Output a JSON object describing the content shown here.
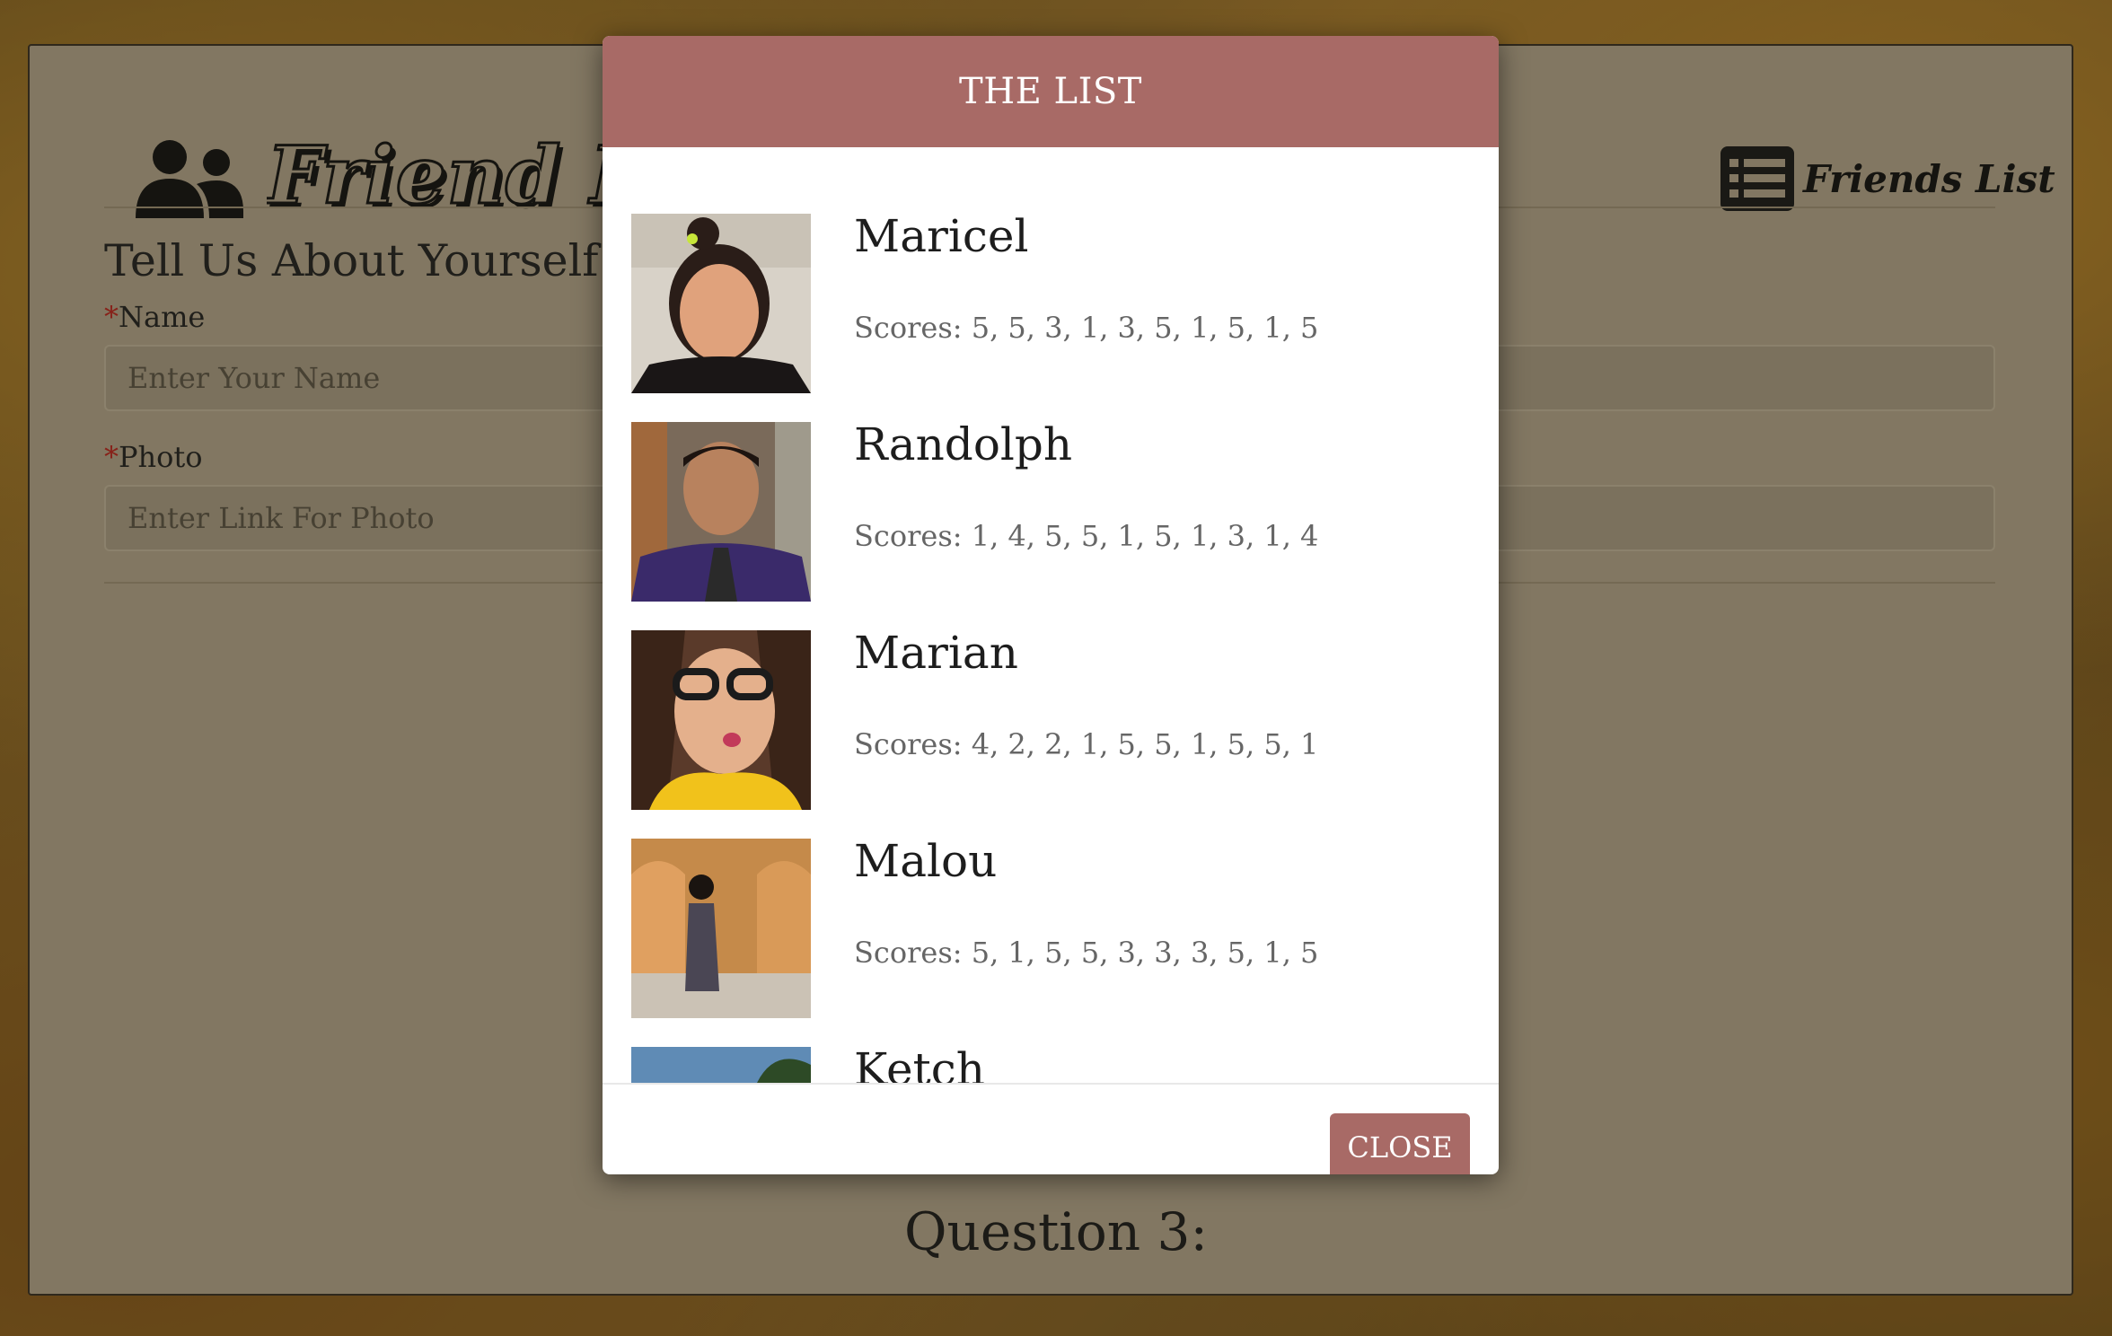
{
  "brand": {
    "title": "Friend Finder",
    "icon": "users-icon"
  },
  "nav": {
    "friends_list_label": "Friends List",
    "icon": "list-icon"
  },
  "form": {
    "section_title": "Tell Us About Yourself!",
    "required_mark": "*",
    "name_label": "Name",
    "name_placeholder": "Enter Your Name",
    "photo_label": "Photo",
    "photo_placeholder": "Enter Link For Photo"
  },
  "question": {
    "title": "Question 3:"
  },
  "modal": {
    "title": "THE LIST",
    "close_label": "CLOSE",
    "friends": [
      {
        "name": "Maricel",
        "scores": "Scores: 5, 5, 3, 1, 3, 5, 1, 5, 1, 5"
      },
      {
        "name": "Randolph",
        "scores": "Scores: 1, 4, 5, 5, 1, 5, 1, 3, 1, 4"
      },
      {
        "name": "Marian",
        "scores": "Scores: 4, 2, 2, 1, 5, 5, 1, 5, 5, 1"
      },
      {
        "name": "Malou",
        "scores": "Scores: 5, 1, 5, 5, 3, 3, 3, 5, 1, 5"
      },
      {
        "name": "Ketch",
        "scores": ""
      }
    ]
  },
  "colors": {
    "accent": "#a86a66",
    "card": "#b9aa8f",
    "required": "#c0261f"
  }
}
